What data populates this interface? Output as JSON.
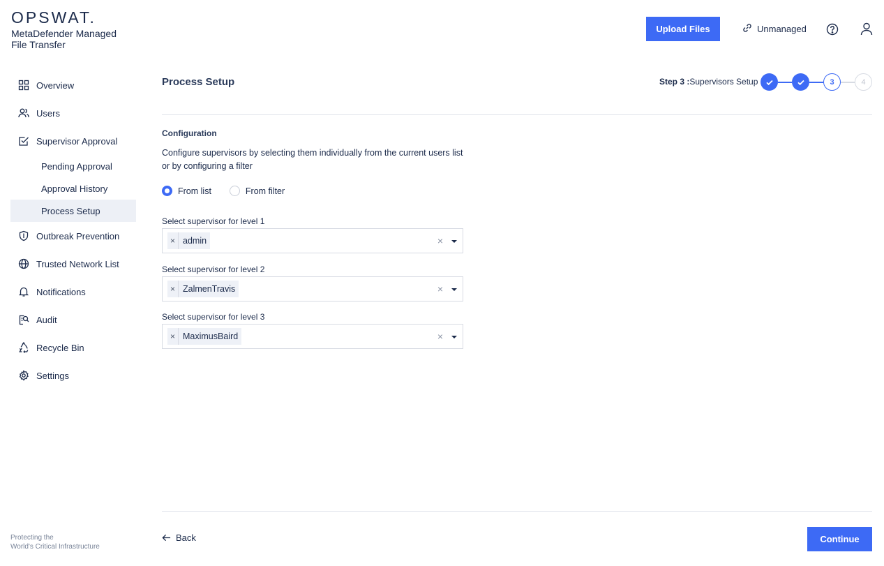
{
  "brand": {
    "logo": "OPSWAT.",
    "product_line1": "MetaDefender Managed",
    "product_line2": "File Transfer",
    "tagline_line1": "Protecting the",
    "tagline_line2": "World's Critical Infrastructure"
  },
  "header": {
    "upload_label": "Upload Files",
    "unmanaged_label": "Unmanaged",
    "icons": [
      "link-icon",
      "help-icon",
      "user-icon"
    ]
  },
  "sidebar": {
    "items": [
      {
        "label": "Overview",
        "icon": "grid-icon"
      },
      {
        "label": "Users",
        "icon": "users-icon"
      },
      {
        "label": "Supervisor Approval",
        "icon": "checkbox-icon"
      },
      {
        "label": "Pending Approval"
      },
      {
        "label": "Approval History"
      },
      {
        "label": "Process Setup",
        "active": true
      },
      {
        "label": "Outbreak Prevention",
        "icon": "shield-icon"
      },
      {
        "label": "Trusted Network List",
        "icon": "globe-icon"
      },
      {
        "label": "Notifications",
        "icon": "bell-icon"
      },
      {
        "label": "Audit",
        "icon": "audit-icon"
      },
      {
        "label": "Recycle Bin",
        "icon": "recycle-icon"
      },
      {
        "label": "Settings",
        "icon": "gear-icon"
      }
    ]
  },
  "main": {
    "title": "Process Setup",
    "step_prefix": "Step 3 :",
    "step_name": "Supervisors Setup",
    "steps": [
      "✓",
      "✓",
      "3",
      "4"
    ],
    "section_title": "Configuration",
    "description": "Configure supervisors by selecting them individually from the current users list or by configuring a filter",
    "radio_options": [
      {
        "label": "From list",
        "selected": true
      },
      {
        "label": "From filter",
        "selected": false
      }
    ],
    "levels": [
      {
        "label": "Select supervisor for level 1",
        "value": "admin"
      },
      {
        "label": "Select supervisor for level 2",
        "value": "ZalmenTravis"
      },
      {
        "label": "Select supervisor for level 3",
        "value": "MaximusBaird"
      }
    ],
    "tag_remove": "×",
    "clear_symbol": "×"
  },
  "footer": {
    "back_label": "Back",
    "continue_label": "Continue"
  },
  "colors": {
    "accent": "#3d6af5",
    "text": "#1b2a4a",
    "active_bg": "#edf0f6",
    "divider": "#dfe3ea"
  }
}
